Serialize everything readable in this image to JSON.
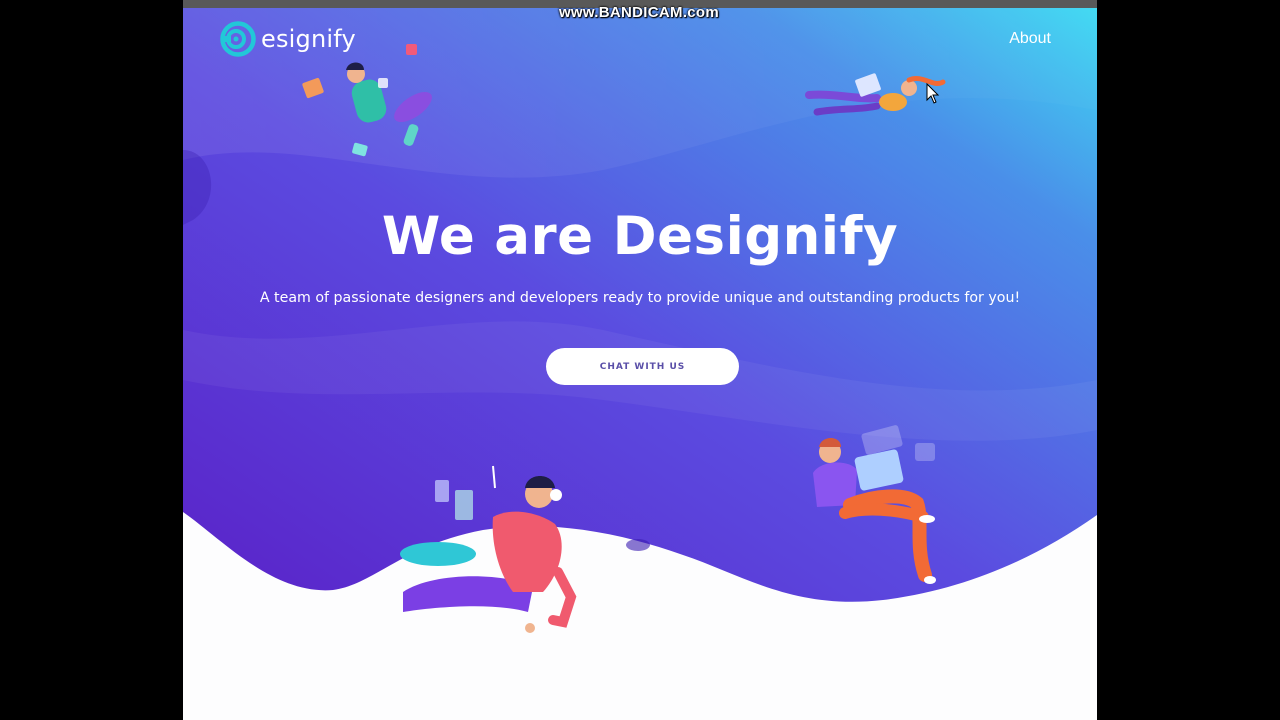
{
  "recording_watermark": "www.BANDICAM.com",
  "nav": {
    "logo_text": "esignify",
    "about_label": "About"
  },
  "hero": {
    "title": "We are Designify",
    "subtitle": "A team of passionate designers and developers ready to provide unique and outstanding products for you!",
    "cta_label": "CHAT WITH US"
  },
  "colors": {
    "gradient_start": "#5b2fcf",
    "gradient_mid": "#4a62e6",
    "gradient_end": "#3fd6f3",
    "logo_accent": "#22c7d8",
    "cta_text": "#5a4fa8"
  },
  "icons": [
    "logo-icon",
    "cursor-icon"
  ]
}
